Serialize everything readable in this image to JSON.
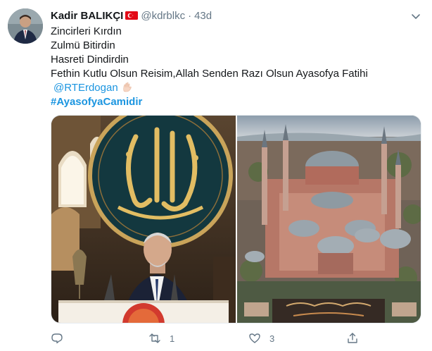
{
  "user": {
    "name": "Kadir BALIKÇI",
    "handle": "@kdrblkc",
    "separator": "·",
    "time": "43d",
    "flag_icon": "turkey-flag-icon",
    "avatar_icon": "avatar"
  },
  "tweet": {
    "lines": [
      "Zincirleri Kırdın",
      "Zulmü Bitirdin",
      "Hasreti Dindirdin",
      "Fethin Kutlu Olsun Reisim,Allah Senden Razı Olsun Ayasofya Fatihi"
    ],
    "mention": "@RTErdogan",
    "mention_emoji": "raised-hands-icon",
    "hashtag": "#AyasofyaCamidir"
  },
  "media": [
    {
      "name": "photo-speaker-under-calligraphy"
    },
    {
      "name": "photo-hagia-sophia-aerial"
    }
  ],
  "actions": {
    "reply_count": "",
    "retweet_count": "1",
    "like_count": "3",
    "share_count": ""
  },
  "colors": {
    "link": "#1b95e0",
    "muted": "#657786",
    "text": "#14171a"
  }
}
